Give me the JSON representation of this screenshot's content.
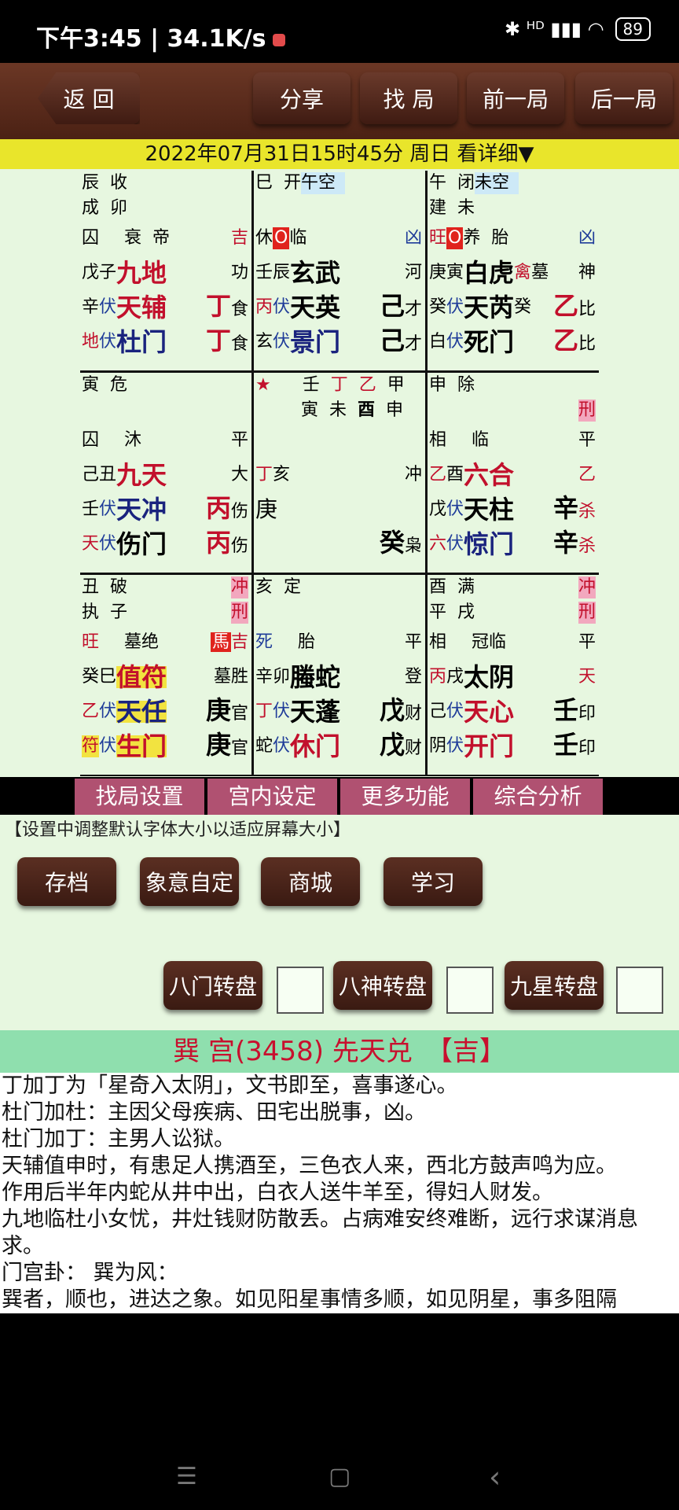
{
  "status": {
    "time": "下午3:45 | 34.1K/s",
    "icons": "✱ ᴴᴰ ▮▮▮ ◠",
    "battery": "89"
  },
  "topbar": {
    "back": "返 回",
    "share": "分享",
    "find": "找 局",
    "prev": "前一局",
    "next": "后一局"
  },
  "datebar": "2022年07月31日15时45分 周日 看详细▼",
  "palaces": {
    "p1": {
      "r1a": "辰",
      "r1b": "收",
      "r2a": "成",
      "r2b": "卯",
      "r3a": "囚",
      "r3b": "衰",
      "r3c": "帝",
      "r3d": "吉",
      "r4a": "戊",
      "r4b": "子",
      "r4c": "九地",
      "r4d": "功",
      "r5a": "辛",
      "r5b": "伏",
      "r5c": "天辅",
      "r5d": "丁",
      "r5e": "食",
      "r6a": "地",
      "r6b": "伏",
      "r6c": "杜门",
      "r6d": "丁",
      "r6e": "食"
    },
    "p2": {
      "r1a": "巳",
      "r1b": "开",
      "r1c": "午空",
      "r3a": "休",
      "r3b": "O",
      "r3c": "临",
      "r3d": "凶",
      "r4a": "壬",
      "r4b": "辰",
      "r4c": "玄武",
      "r4d": "河",
      "r5a": "丙",
      "r5b": "伏",
      "r5c": "天英",
      "r5d": "己",
      "r5e": "才",
      "r6a": "玄",
      "r6b": "伏",
      "r6c": "景门",
      "r6d": "己",
      "r6e": "才"
    },
    "p3": {
      "r1a": "午",
      "r1b": "闭",
      "r1c": "未空",
      "r2a": "建",
      "r2b": "未",
      "r3a": "旺",
      "r3b": "O",
      "r3c": "养",
      "r3d": "胎",
      "r3e": "凶",
      "r4a": "庚",
      "r4b": "寅",
      "r4c": "白虎",
      "r4d": "禽",
      "r4e": "墓",
      "r4f": "神",
      "r5a": "癸",
      "r5b": "伏",
      "r5c": "天芮",
      "r5d": "癸",
      "r5e": "乙",
      "r5f": "比",
      "r6a": "白",
      "r6b": "伏",
      "r6c": "死门",
      "r6d": "乙",
      "r6e": "比"
    },
    "p4": {
      "r1a": "寅",
      "r1b": "危",
      "r3a": "囚",
      "r3b": "沐",
      "r3c": "平",
      "r4a": "己",
      "r4b": "丑",
      "r4c": "九天",
      "r4d": "大",
      "r5a": "壬",
      "r5b": "伏",
      "r5c": "天冲",
      "r5d": "丙",
      "r5e": "伤",
      "r6a": "天",
      "r6b": "伏",
      "r6c": "伤门",
      "r6d": "丙",
      "r6e": "伤"
    },
    "p5": {
      "star": "★",
      "r1a": "壬",
      "r1b": "丁",
      "r1c": "乙",
      "r1d": "甲",
      "r2a": "寅",
      "r2b": "未",
      "r2c": "酉",
      "r2d": "申",
      "r4a": "丁",
      "r4b": "亥",
      "r4c": "冲",
      "r5a": "庚",
      "r6a": "癸",
      "r6b": "枭"
    },
    "p6": {
      "r1a": "申",
      "r1b": "除",
      "r2a": "刑",
      "r3a": "相",
      "r3b": "临",
      "r3c": "平",
      "r4a": "乙",
      "r4b": "酉",
      "r4c": "六合",
      "r4d": "乙",
      "r5a": "戊",
      "r5b": "伏",
      "r5c": "天柱",
      "r5d": "辛",
      "r5e": "杀",
      "r6a": "六",
      "r6b": "伏",
      "r6c": "惊门",
      "r6d": "辛",
      "r6e": "杀"
    },
    "p7": {
      "r1a": "丑",
      "r1b": "破",
      "r1c": "冲",
      "r2a": "执",
      "r2b": "子",
      "r2c": "刑",
      "r3a": "旺",
      "r3b": "墓",
      "r3c": "绝",
      "r3d": "馬",
      "r3e": "吉",
      "r4a": "癸",
      "r4b": "巳",
      "r4c": "值符",
      "r4d": "墓",
      "r4e": "胜",
      "r5a": "乙",
      "r5b": "伏",
      "r5c": "天任",
      "r5d": "庚",
      "r5e": "官",
      "r6a": "符",
      "r6b": "伏",
      "r6c": "生门",
      "r6d": "庚",
      "r6e": "官"
    },
    "p8": {
      "r1a": "亥",
      "r1b": "定",
      "r3a": "死",
      "r3b": "胎",
      "r3c": "平",
      "r4a": "辛",
      "r4b": "卯",
      "r4c": "螣蛇",
      "r4d": "登",
      "r5a": "丁",
      "r5b": "伏",
      "r5c": "天蓬",
      "r5d": "戊",
      "r5e": "财",
      "r6a": "蛇",
      "r6b": "伏",
      "r6c": "休门",
      "r6d": "戊",
      "r6e": "财"
    },
    "p9": {
      "r1a": "酉",
      "r1b": "满",
      "r1c": "冲",
      "r2a": "平",
      "r2b": "戌",
      "r2c": "刑",
      "r3a": "相",
      "r3b": "冠",
      "r3c": "临",
      "r3d": "平",
      "r4a": "丙",
      "r4b": "戌",
      "r4c": "太阴",
      "r4d": "天",
      "r5a": "己",
      "r5b": "伏",
      "r5c": "天心",
      "r5d": "壬",
      "r5e": "印",
      "r6a": "阴",
      "r6b": "伏",
      "r6c": "开门",
      "r6d": "壬",
      "r6e": "印"
    }
  },
  "tabs": [
    "找局设置",
    "宫内设定",
    "更多功能",
    "综合分析"
  ],
  "hint": "【设置中调整默认字体大小以适应屏幕大小】",
  "buttons": {
    "save": "存档",
    "custom": "象意自定",
    "shop": "商城",
    "learn": "学习",
    "bamen": "八门转盘",
    "bashen": "八神转盘",
    "jiuxing": "九星转盘"
  },
  "gong_title": "巽 宫(3458) 先天兑　【吉】",
  "desc_lines": [
    "丁加丁为「星奇入太阴」，文书即至，喜事遂心。",
    "杜门加杜：主因父母疾病、田宅出脱事，凶。",
    "杜门加丁：主男人讼狱。",
    "天辅值申时，有患足人携酒至，三色衣人来，西北方鼓声鸣为应。",
    "作用后半年内蛇从井中出，白衣人送牛羊至，得妇人财发。",
    "九地临杜小女忧，井灶钱财防散丢。占病难安终难断，远行求谋消息求。",
    "门宫卦：  巽为风：",
    "巽者，顺也，进达之象。如见阳星事情多顺，如见阴星，事多阻隔"
  ],
  "nav": {
    "menu": "☰",
    "home": "▢",
    "back": "‹"
  },
  "colors": {
    "accent_red": "#c2102c",
    "board_bg": "#e7f7e0",
    "date_bar": "#e9e52b",
    "tab_bg": "#b05171",
    "gong_bar": "#8fdfae"
  }
}
